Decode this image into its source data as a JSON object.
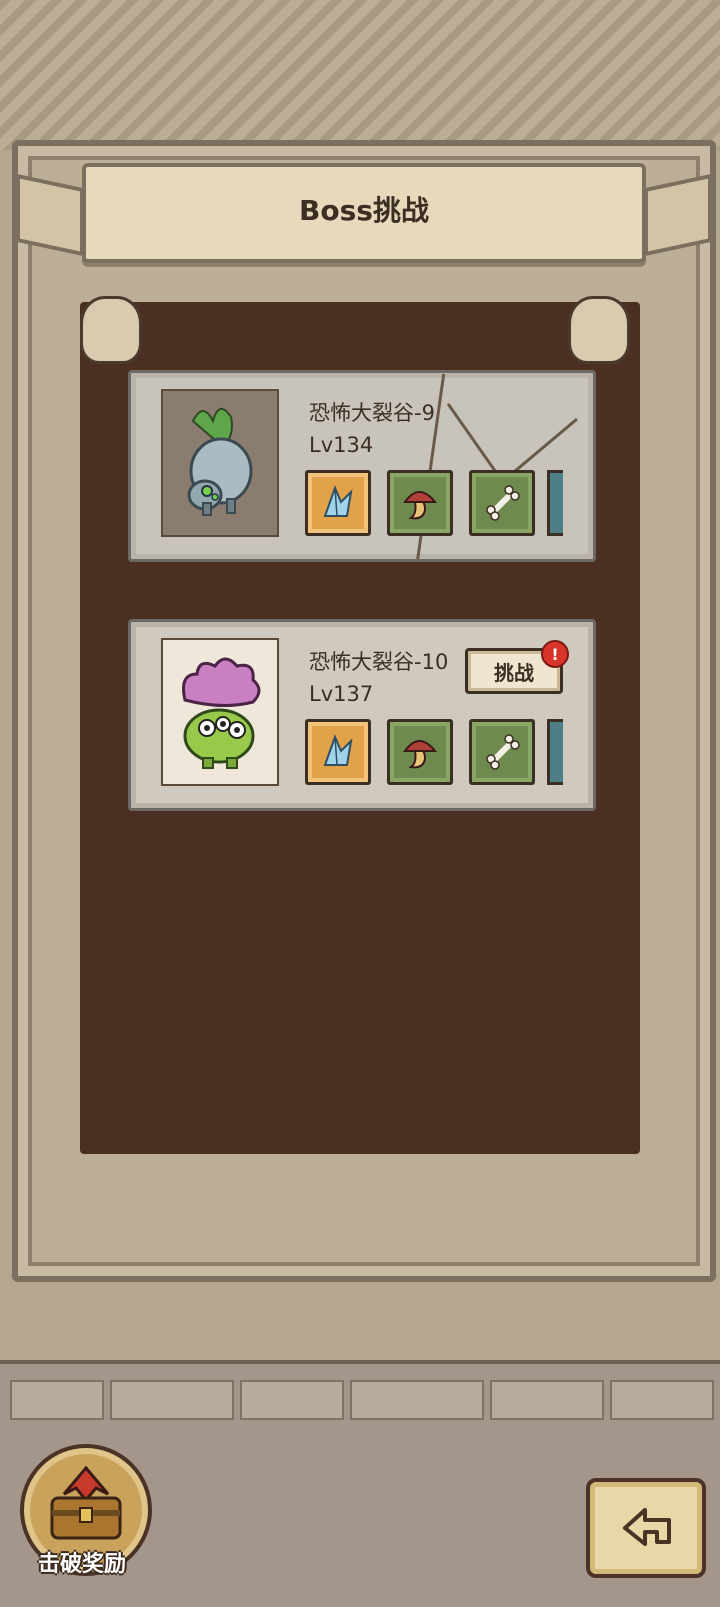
{
  "header": {
    "title": "Boss挑战"
  },
  "bosses": [
    {
      "name": "恐怖大裂谷-9",
      "level": "Lv134",
      "rewards": [
        "crystal-icon",
        "mushroom-icon",
        "bone-icon"
      ]
    },
    {
      "name": "恐怖大裂谷-10",
      "level": "Lv137",
      "challenge_label": "挑战",
      "alert": "!",
      "rewards": [
        "crystal-icon",
        "mushroom-icon",
        "bone-icon"
      ]
    }
  ],
  "footer": {
    "reward_label": "击破奖励",
    "back_icon": "back-arrow-icon"
  },
  "colors": {
    "panel": "#4a2f22",
    "card": "#cfc9c0",
    "reward_gold": "#e2a24a",
    "reward_green": "#6f8a4e",
    "alert": "#d8342a"
  }
}
